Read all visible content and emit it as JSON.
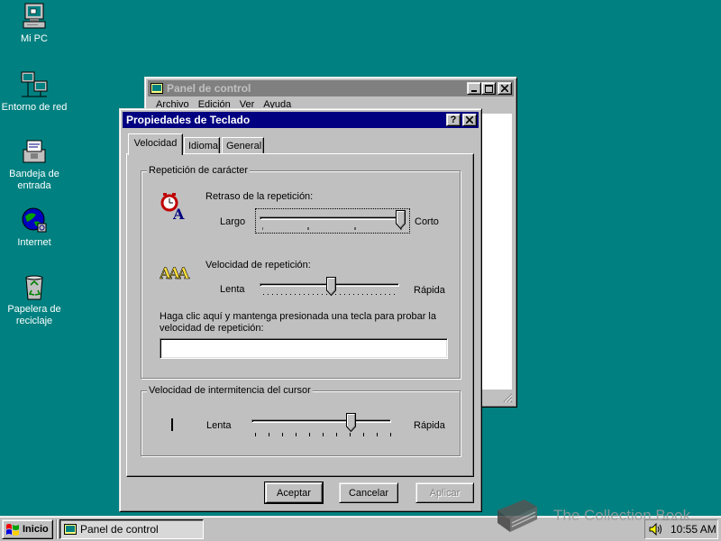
{
  "desktop": {
    "icons": [
      {
        "label": "Mi PC",
        "icon": "my-computer-icon"
      },
      {
        "label": "Entorno de red",
        "icon": "network-neighborhood-icon"
      },
      {
        "label": "Bandeja de entrada",
        "icon": "inbox-icon"
      },
      {
        "label": "Internet",
        "icon": "internet-icon"
      },
      {
        "label": "Papelera de reciclaje",
        "icon": "recycle-bin-icon"
      }
    ]
  },
  "control_panel": {
    "title": "Panel de control",
    "menu": [
      "Archivo",
      "Edición",
      "Ver",
      "Ayuda"
    ]
  },
  "dialog": {
    "title": "Propiedades de Teclado",
    "help_button": "?",
    "close_button": "×",
    "tabs": [
      "Velocidad",
      "Idioma",
      "General"
    ],
    "active_tab": "Velocidad",
    "repeat_group": {
      "legend": "Repetición de carácter",
      "delay": {
        "label": "Retraso de la repetición:",
        "min_label": "Largo",
        "max_label": "Corto",
        "value": 1.0
      },
      "rate": {
        "label": "Velocidad de repetición:",
        "min_label": "Lenta",
        "max_label": "Rápida",
        "value": 0.48
      },
      "test_label_line1": "Haga clic aquí y mantenga presionada una tecla para probar la",
      "test_label_line2": "velocidad de repetición:",
      "test_input_value": ""
    },
    "cursor_group": {
      "legend": "Velocidad de intermitencia del cursor",
      "min_label": "Lenta",
      "max_label": "Rápida",
      "value": 0.68
    },
    "buttons": {
      "ok": "Aceptar",
      "cancel": "Cancelar",
      "apply": "Aplicar"
    }
  },
  "taskbar": {
    "start_label": "Inicio",
    "task_label": "Panel de control",
    "clock": "10:55 AM"
  },
  "watermark": "The Collection Book"
}
